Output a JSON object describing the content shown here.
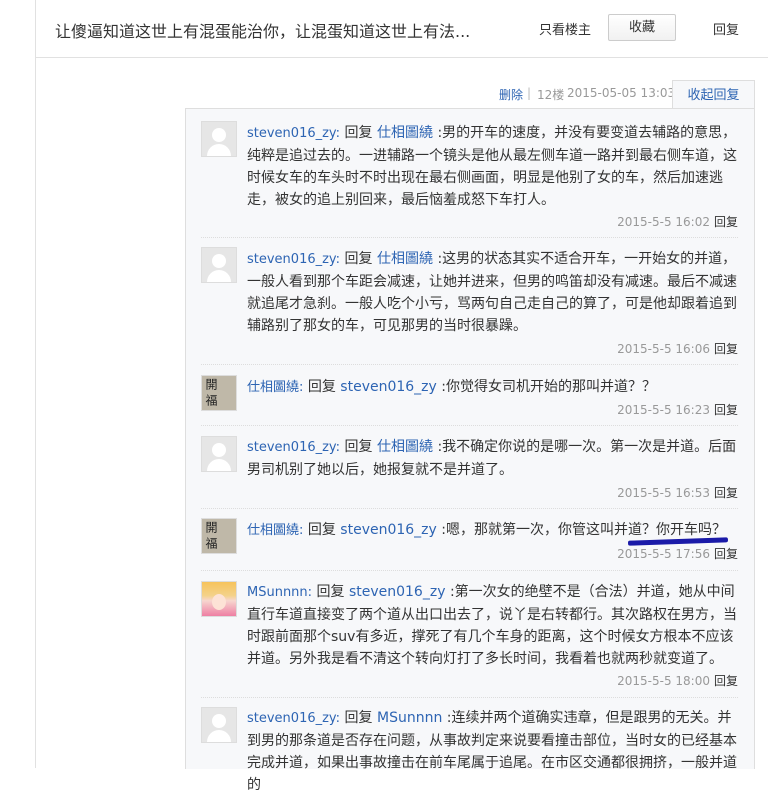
{
  "header": {
    "title": "让傻逼知道这世上有混蛋能治你，让混蛋知道这世上有法...",
    "only_op": "只看楼主",
    "favorite": "收藏",
    "reply": "回复"
  },
  "post_meta": {
    "delete": "删除",
    "separator": "|",
    "floor": "12楼",
    "time": "2015-05-05 13:03",
    "collapse_reply": "收起回复"
  },
  "replies": [
    {
      "user": "steven016_zy:",
      "reply_word": "回复",
      "target": "仕相圖繞",
      "content": ":男的开车的速度，并没有要变道去辅路的意思，纯粹是追过去的。一进辅路一个镜头是他从最左侧车道一路并到最右侧车道，这时候女车的车头时不时出现在最右侧画面，明显是他别了女的车，然后加速逃走，被女的追上别回来，最后恼羞成怒下车打人。",
      "time": "2015-5-5 16:02",
      "reply": "回复",
      "avatar": "default-avatar-icon"
    },
    {
      "user": "steven016_zy:",
      "reply_word": "回复",
      "target": "仕相圖繞",
      "content": ":这男的状态其实不适合开车，一开始女的并道，一般人看到那个车距会减速，让她并进来，但男的鸣笛却没有减速。最后不减速就追尾才急刹。一般人吃个小亏，骂两句自己走自己的算了，可是他却跟着追到辅路别了那女的车，可见那男的当时很暴躁。",
      "time": "2015-5-5 16:06",
      "reply": "回复",
      "avatar": "default-avatar-icon"
    },
    {
      "user": "仕相圖繞:",
      "reply_word": "回复",
      "target": "steven016_zy",
      "content": ":你觉得女司机开始的那叫并道？？",
      "time": "2015-5-5 16:23",
      "reply": "回复",
      "avatar": "calligraphy-avatar-icon"
    },
    {
      "user": "steven016_zy:",
      "reply_word": "回复",
      "target": "仕相圖繞",
      "content": ":我不确定你说的是哪一次。第一次是并道。后面男司机别了她以后，她报复就不是并道了。",
      "time": "2015-5-5 16:53",
      "reply": "回复",
      "avatar": "default-avatar-icon"
    },
    {
      "user": "仕相圖繞:",
      "reply_word": "回复",
      "target": "steven016_zy",
      "content": ":嗯，那就第一次，你管这叫并道？你开车吗？",
      "time": "2015-5-5 17:56",
      "reply": "回复",
      "avatar": "calligraphy-avatar-icon"
    },
    {
      "user": "MSunnnn:",
      "reply_word": "回复",
      "target": "steven016_zy",
      "content": ":第一次女的绝壁不是（合法）并道，她从中间直行车道直接变了两个道从出口出去了，说丫是右转都行。其次路权在男方，当时跟前面那个suv有多近，撑死了有几个车身的距离，这个时候女方根本不应该并道。另外我是看不清这个转向灯打了多长时间，我看着也就两秒就变道了。",
      "time": "2015-5-5 18:00",
      "reply": "回复",
      "avatar": "anime-avatar-icon"
    },
    {
      "user": "steven016_zy:",
      "reply_word": "回复",
      "target": "MSunnnn",
      "content": ":连续并两个道确实违章，但是跟男的无关。并到男的那条道是否存在问题，从事故判定来说要看撞击部位，当时女的已经基本完成并道，如果出事故撞击在前车尾属于追尾。在市区交通都很拥挤，一般并道的",
      "time": "",
      "reply": "",
      "avatar": "default-avatar-icon"
    }
  ]
}
